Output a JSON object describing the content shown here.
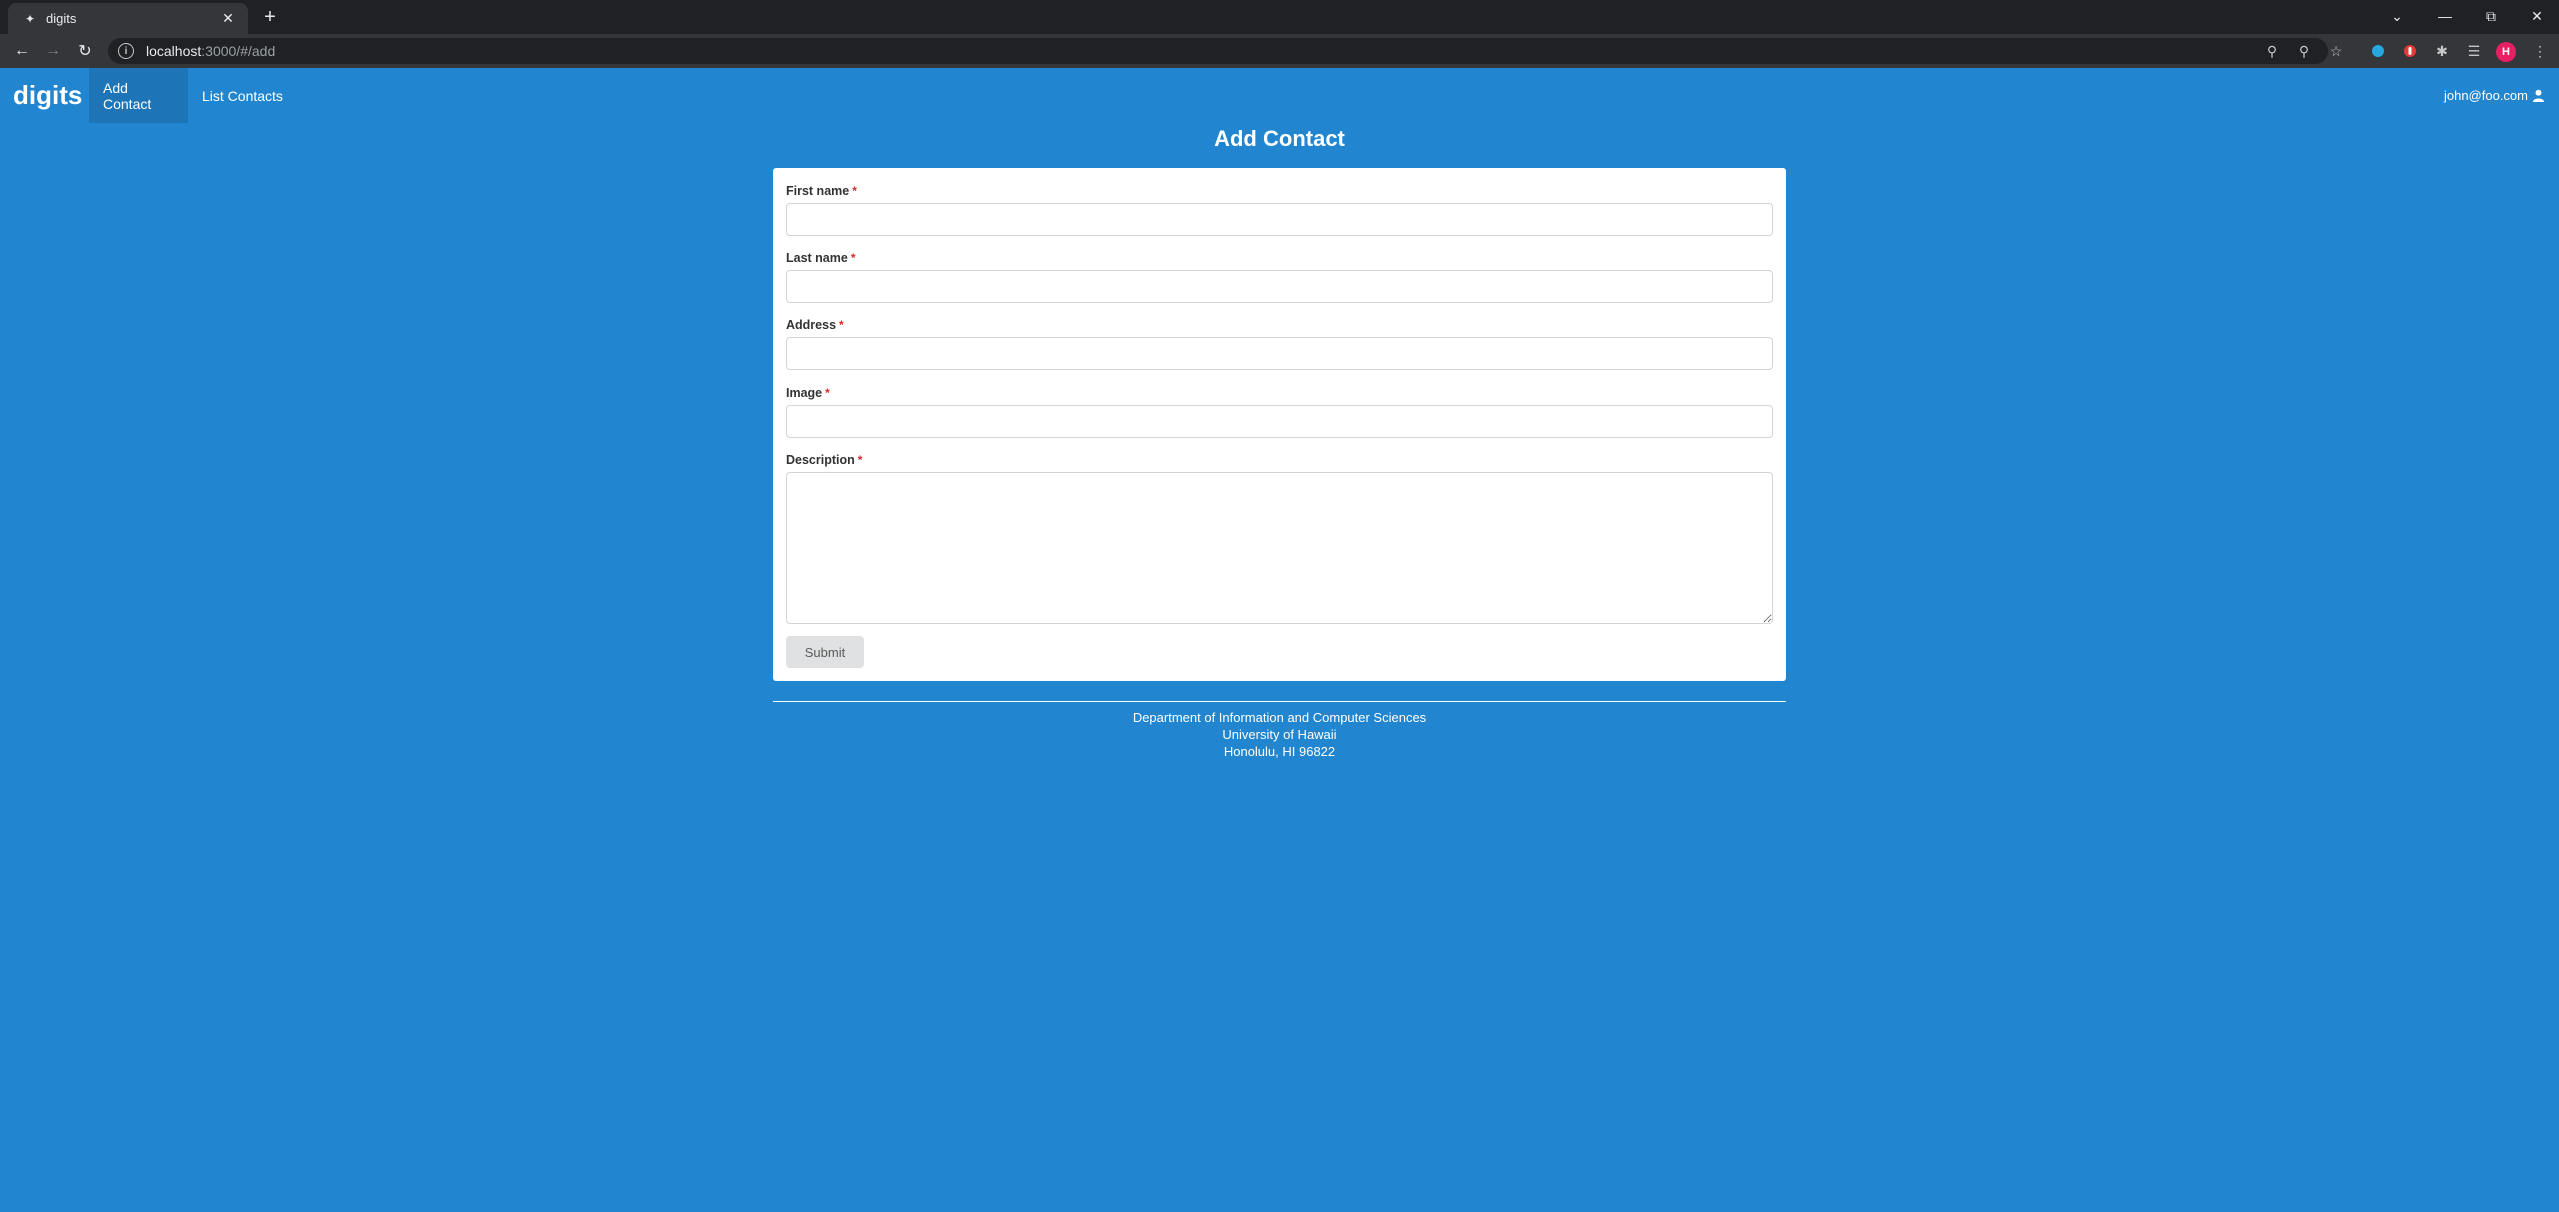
{
  "browser": {
    "tab_title": "digits",
    "url_host": "localhost",
    "url_path": ":3000/#/add",
    "profile_initial": "H",
    "icons": [
      "key-icon",
      "zoom-icon",
      "star-icon",
      "extension-icon",
      "media-icon",
      "puzzle-icon",
      "reading-list-icon",
      "menu-icon"
    ]
  },
  "navbar": {
    "brand": "digits",
    "items": [
      {
        "label": "Add Contact",
        "active": true
      },
      {
        "label": "List Contacts",
        "active": false
      }
    ],
    "user": "john@foo.com"
  },
  "page": {
    "title": "Add Contact"
  },
  "form": {
    "fields": [
      {
        "label": "First name",
        "required_mark": "*",
        "value": ""
      },
      {
        "label": "Last name",
        "required_mark": "*",
        "value": ""
      },
      {
        "label": "Address",
        "required_mark": "*",
        "value": ""
      },
      {
        "label": "Image",
        "required_mark": "*",
        "value": ""
      },
      {
        "label": "Description",
        "required_mark": "*",
        "value": ""
      }
    ],
    "submit_label": "Submit"
  },
  "footer": {
    "line1": "Department of Information and Computer Sciences",
    "line2": "University of Hawaii",
    "line3": "Honolulu, HI 96822"
  },
  "colors": {
    "page_background": "#2185d0",
    "required_mark": "#db2828"
  }
}
